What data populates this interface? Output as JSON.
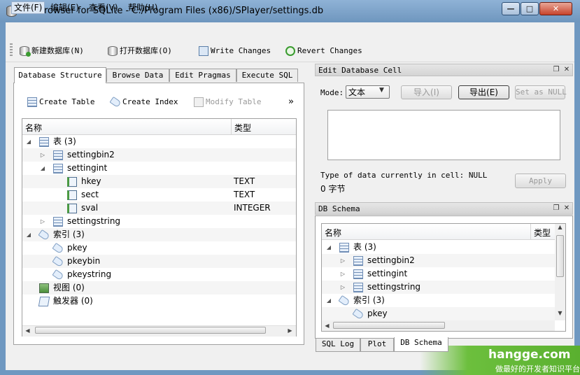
{
  "window": {
    "title": "DB Browser for SQLite - C:/Program Files (x86)/SPlayer/settings.db",
    "minimize": "—",
    "maximize": "□",
    "close": "✕"
  },
  "menu": [
    "文件(F)",
    "编辑(E)",
    "查看(V)",
    "帮助(H)"
  ],
  "toolbar": {
    "new_db": "新建数据库(N)",
    "open_db": "打开数据库(O)",
    "write_changes": "Write Changes",
    "revert_changes": "Revert Changes"
  },
  "tabs": [
    "Database Structure",
    "Browse Data",
    "Edit Pragmas",
    "Execute SQL"
  ],
  "structure_actions": {
    "create_table": "Create Table",
    "create_index": "Create Index",
    "modify_table": "Modify Table",
    "more": "»"
  },
  "tree": {
    "col_name": "名称",
    "col_type": "类型",
    "rows": [
      {
        "name": "表 (3)",
        "type": ""
      },
      {
        "name": "settingbin2",
        "type": ""
      },
      {
        "name": "settingint",
        "type": ""
      },
      {
        "name": "hkey",
        "type": "TEXT"
      },
      {
        "name": "sect",
        "type": "TEXT"
      },
      {
        "name": "sval",
        "type": "INTEGER"
      },
      {
        "name": "settingstring",
        "type": ""
      },
      {
        "name": "索引 (3)",
        "type": ""
      },
      {
        "name": "pkey",
        "type": ""
      },
      {
        "name": "pkeybin",
        "type": ""
      },
      {
        "name": "pkeystring",
        "type": ""
      },
      {
        "name": "视图 (0)",
        "type": ""
      },
      {
        "name": "触发器 (0)",
        "type": ""
      }
    ]
  },
  "edit_cell": {
    "title": "Edit Database Cell",
    "mode_label": "Mode:",
    "mode_value": "文本",
    "import": "导入(I)",
    "export": "导出(E)",
    "set_null": "Set as NULL",
    "type_info": "Type of data currently in cell: NULL",
    "size_info": "0 字节",
    "apply": "Apply"
  },
  "schema": {
    "title": "DB Schema",
    "col_name": "名称",
    "col_type": "类型",
    "rows": [
      {
        "name": "表 (3)"
      },
      {
        "name": "settingbin2"
      },
      {
        "name": "settingint"
      },
      {
        "name": "settingstring"
      },
      {
        "name": "索引 (3)"
      },
      {
        "name": "pkey"
      }
    ]
  },
  "bottom_tabs": [
    "SQL Log",
    "Plot",
    "DB Schema"
  ],
  "watermark": {
    "site": "hangge.com",
    "slogan": "做最好的开发者知识平台"
  }
}
